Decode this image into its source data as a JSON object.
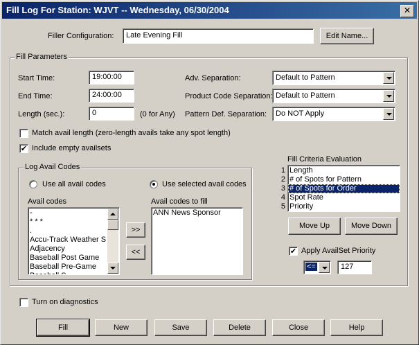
{
  "window": {
    "title": "Fill Log For Station: WJVT -- Wednesday, 06/30/2004"
  },
  "filler": {
    "label": "Filler Configuration:",
    "value": "Late Evening Fill",
    "edit_name": "Edit Name..."
  },
  "params": {
    "group_label": "Fill Parameters",
    "start_label": "Start Time:",
    "start_value": "19:00:00",
    "end_label": "End Time:",
    "end_value": "24:00:00",
    "length_label": "Length (sec.):",
    "length_value": "0",
    "length_hint": "(0 for Any)",
    "adv_sep_label": "Adv. Separation:",
    "adv_sep_value": "Default to Pattern",
    "prod_sep_label": "Product Code Separation:",
    "prod_sep_value": "Default to Pattern",
    "pattern_sep_label": "Pattern Def. Separation:",
    "pattern_sep_value": "Do NOT Apply",
    "match_avail_label": "Match avail length (zero-length avails take any spot length)",
    "match_avail_checked": false,
    "include_empty_label": "Include empty availsets",
    "include_empty_checked": true
  },
  "log_avail": {
    "group_label": "Log Avail Codes",
    "use_all_label": "Use all avail codes",
    "use_selected_label": "Use selected avail codes",
    "selected_mode": "selected",
    "avail_codes_label": "Avail codes",
    "avail_codes": [
      "-",
      "* * *",
      ".",
      "Accu-Track Weather S",
      "Adjacency",
      "Baseball Post Game",
      "Baseball Pre-Game",
      "Baseball S..."
    ],
    "fill_label": "Avail codes to fill",
    "fill_codes": [
      "ANN News Sponsor"
    ],
    "add_button": ">>",
    "remove_button": "<<"
  },
  "criteria": {
    "label": "Fill Criteria Evaluation",
    "items": [
      {
        "num": "1",
        "label": "Length"
      },
      {
        "num": "2",
        "label": "# of Spots for Pattern"
      },
      {
        "num": "3",
        "label": "# of Spots for Order"
      },
      {
        "num": "4",
        "label": "Spot Rate"
      },
      {
        "num": "5",
        "label": "Priority"
      }
    ],
    "selected_index": 2,
    "move_up": "Move Up",
    "move_down": "Move Down",
    "apply_priority_label": "Apply AvailSet Priority",
    "apply_priority_checked": true,
    "operator": "<=",
    "priority_value": "127"
  },
  "diagnostics": {
    "label": "Turn on diagnostics",
    "checked": false
  },
  "buttons": {
    "fill": "Fill",
    "new": "New",
    "save": "Save",
    "delete": "Delete",
    "close": "Close",
    "help": "Help"
  },
  "colors": {
    "title_start": "#0a246a",
    "title_end": "#3a6ea5",
    "face": "#d4d0c8",
    "selection": "#0a246a"
  }
}
